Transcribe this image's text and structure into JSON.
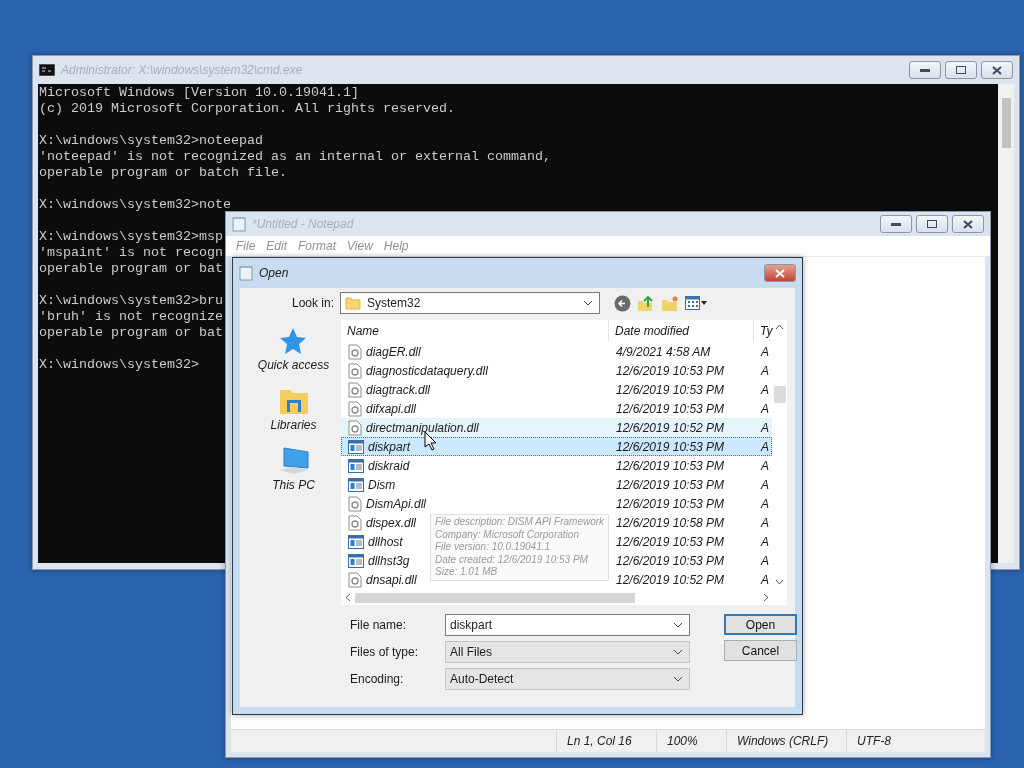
{
  "console": {
    "title": "Administrator: X:\\windows\\system32\\cmd.exe",
    "blocks": [
      [
        "Microsoft Windows [Version 10.0.19041.1]",
        "(c) 2019 Microsoft Corporation. All rights reserved."
      ],
      [
        "X:\\windows\\system32>noteepad",
        "'noteepad' is not recognized as an internal or external command,",
        "operable program or batch file."
      ],
      [
        "X:\\windows\\system32>note"
      ],
      [
        "X:\\windows\\system32>msp",
        "'mspaint' is not recogn",
        "operable program or bat"
      ],
      [
        "X:\\windows\\system32>bru",
        "'bruh' is not recognize",
        "operable program or bat"
      ],
      [
        "X:\\windows\\system32>"
      ]
    ]
  },
  "notepad": {
    "title": "*Untitled - Notepad",
    "menu": [
      "File",
      "Edit",
      "Format",
      "View",
      "Help"
    ],
    "status_bar": [
      "Ln 1, Col 16",
      "100%",
      "Windows (CRLF)",
      "UTF-8"
    ]
  },
  "open_dialog": {
    "title": "Open",
    "look_in": {
      "label": "Look in:",
      "value": "System32"
    },
    "places": [
      {
        "label": "Quick access",
        "kind": "star"
      },
      {
        "label": "Libraries",
        "kind": "library"
      },
      {
        "label": "This PC",
        "kind": "computer"
      }
    ],
    "columns": [
      "Name",
      "Date modified",
      "Ty"
    ],
    "files": [
      {
        "name": "diagER.dll",
        "date": "4/9/2021 4:58 AM",
        "type": "A",
        "kind": "dll",
        "selected": false,
        "hovered": false
      },
      {
        "name": "diagnosticdataquery.dll",
        "date": "12/6/2019 10:53 PM",
        "type": "A",
        "kind": "dll",
        "selected": false,
        "hovered": false
      },
      {
        "name": "diagtrack.dll",
        "date": "12/6/2019 10:53 PM",
        "type": "A",
        "kind": "dll",
        "selected": false,
        "hovered": false
      },
      {
        "name": "difxapi.dll",
        "date": "12/6/2019 10:53 PM",
        "type": "A",
        "kind": "dll",
        "selected": false,
        "hovered": false
      },
      {
        "name": "directmanipulation.dll",
        "date": "12/6/2019 10:52 PM",
        "type": "A",
        "kind": "dll",
        "selected": false,
        "hovered": true
      },
      {
        "name": "diskpart",
        "date": "12/6/2019 10:53 PM",
        "type": "A",
        "kind": "app",
        "selected": true,
        "hovered": false
      },
      {
        "name": "diskraid",
        "date": "12/6/2019 10:53 PM",
        "type": "A",
        "kind": "app",
        "selected": false,
        "hovered": false
      },
      {
        "name": "Dism",
        "date": "12/6/2019 10:53 PM",
        "type": "A",
        "kind": "app",
        "selected": false,
        "hovered": false
      },
      {
        "name": "DismApi.dll",
        "date": "12/6/2019 10:53 PM",
        "type": "A",
        "kind": "dll",
        "selected": false,
        "hovered": false
      },
      {
        "name": "dispex.dll",
        "date": "12/6/2019 10:58 PM",
        "type": "A",
        "kind": "dll",
        "selected": false,
        "hovered": false
      },
      {
        "name": "dllhost",
        "date": "12/6/2019 10:53 PM",
        "type": "A",
        "kind": "app",
        "selected": false,
        "hovered": false
      },
      {
        "name": "dllhst3g",
        "date": "12/6/2019 10:53 PM",
        "type": "A",
        "kind": "app",
        "selected": false,
        "hovered": false
      },
      {
        "name": "dnsapi.dll",
        "date": "12/6/2019 10:52 PM",
        "type": "A",
        "kind": "dll",
        "selected": false,
        "hovered": false
      }
    ],
    "tooltip": [
      "File description: DISM API Framework",
      "Company: Microsoft Corporation",
      "File version: 10.0.19041.1",
      "Date created: 12/6/2019 10:53 PM",
      "Size: 1.01 MB"
    ],
    "fields": [
      {
        "label": "File name:",
        "value": "diskpart",
        "kind": "combo"
      },
      {
        "label": "Files of type:",
        "value": "All Files",
        "kind": "select"
      },
      {
        "label": "Encoding:",
        "value": "Auto-Detect",
        "kind": "select"
      }
    ],
    "buttons": [
      {
        "label": "Open",
        "default": true
      },
      {
        "label": "Cancel",
        "default": false
      }
    ]
  }
}
